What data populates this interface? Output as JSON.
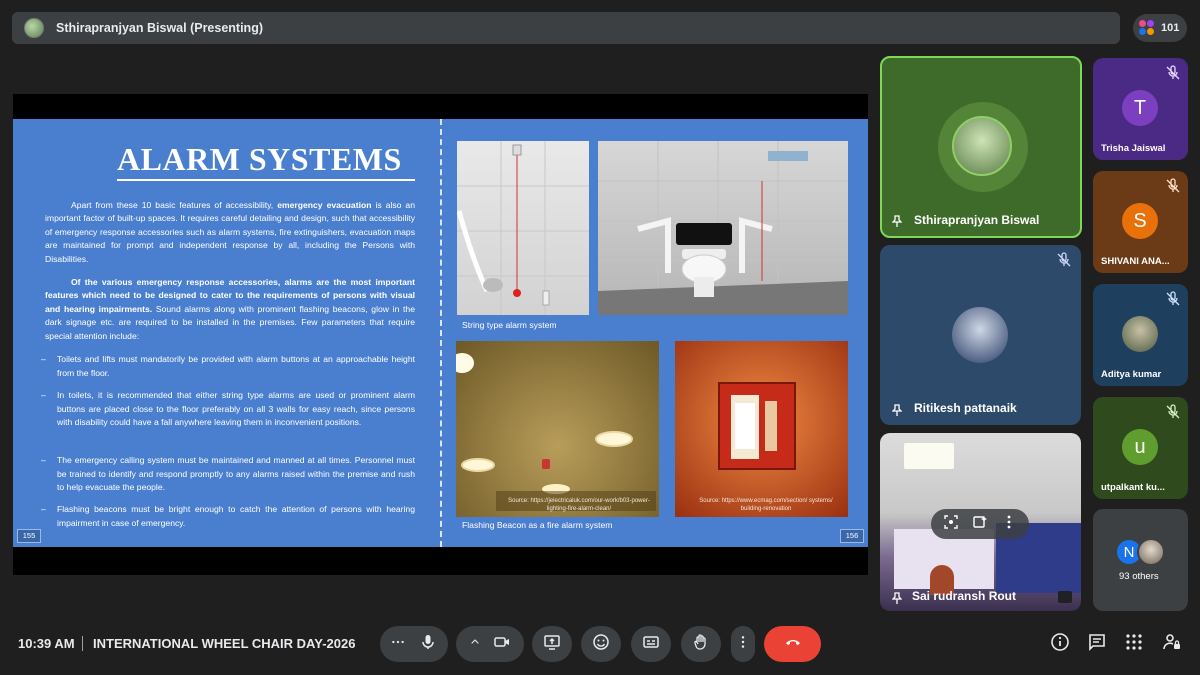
{
  "topbar": {
    "presenter_title": "Sthirapranjyan Biswal (Presenting)"
  },
  "participants_count": "101",
  "slide": {
    "title": "ALARM SYSTEMS",
    "para1_a": "Apart from these 10 basic features of accessibility, ",
    "para1_bold": "emergency evacuation",
    "para1_b": " is also an important factor of built-up spaces. It requires careful detailing and design, such that accessibility of emergency response accessories such as alarm systems, fire extinguishers, evacuation maps are maintained for prompt and independent response by all, including the Persons with Disabilities.",
    "para2_bold": "Of the various emergency response accessories, alarms are the most important features which need to be designed to cater to the requirements of persons with visual and hearing impairments.",
    "para2_b": " Sound alarms along with prominent flashing beacons, glow in the dark signage etc. are required to be installed in the premises. Few parameters that require special attention include:",
    "bullets": [
      "Toilets and lifts must mandatorily be provided with alarm buttons at an approachable height from the floor.",
      "In toilets, it is recommended that either string type alarms are used or prominent alarm buttons are placed close to the floor preferably on all 3 walls for easy reach, since persons with disability could have a fall anywhere leaving them in inconvenient positions.",
      "The emergency calling system must be maintained and manned at all times. Personnel must be trained to identify and respond promptly to any alarms raised within the premise and rush to help evacuate the people.",
      "Flashing beacons must be bright enough to catch the attention of persons with hearing impairment in case of emergency."
    ],
    "page_left": "155",
    "page_right": "156",
    "caption_string": "String type alarm system",
    "caption_beacon": "Flashing Beacon as a fire alarm system",
    "source_1": "Source: https://jelectricaluk.com/our-work/b03-power-lighting-fire-alarm-clean/",
    "source_2": "Source: https://www.ecmag.com/section/ systems/ building-renovation"
  },
  "participants": [
    {
      "name": "Sthirapranjyan Biswal"
    },
    {
      "name": "Ritikesh pattanaik"
    },
    {
      "name": "Sai rudransh Rout"
    },
    {
      "name": "Trisha Jaiswal",
      "initial": "T",
      "color": "#7b3fbf"
    },
    {
      "name": "SHIVANI ANA...",
      "initial": "S",
      "color": "#e8710a"
    },
    {
      "name": "Aditya kumar"
    },
    {
      "name": "utpalkant ku...",
      "initial": "u",
      "color": "#5f9e2e"
    },
    {
      "name": "93 others",
      "initial": "N",
      "color": "#1a73e8"
    }
  ],
  "bottom": {
    "time": "10:39 AM",
    "meeting_title": "INTERNATIONAL WHEEL CHAIR DAY-2026"
  },
  "colors": {
    "end_call": "#ea4335",
    "active_speaker": "#7ed957",
    "slide_bg": "#4a7fd0"
  }
}
